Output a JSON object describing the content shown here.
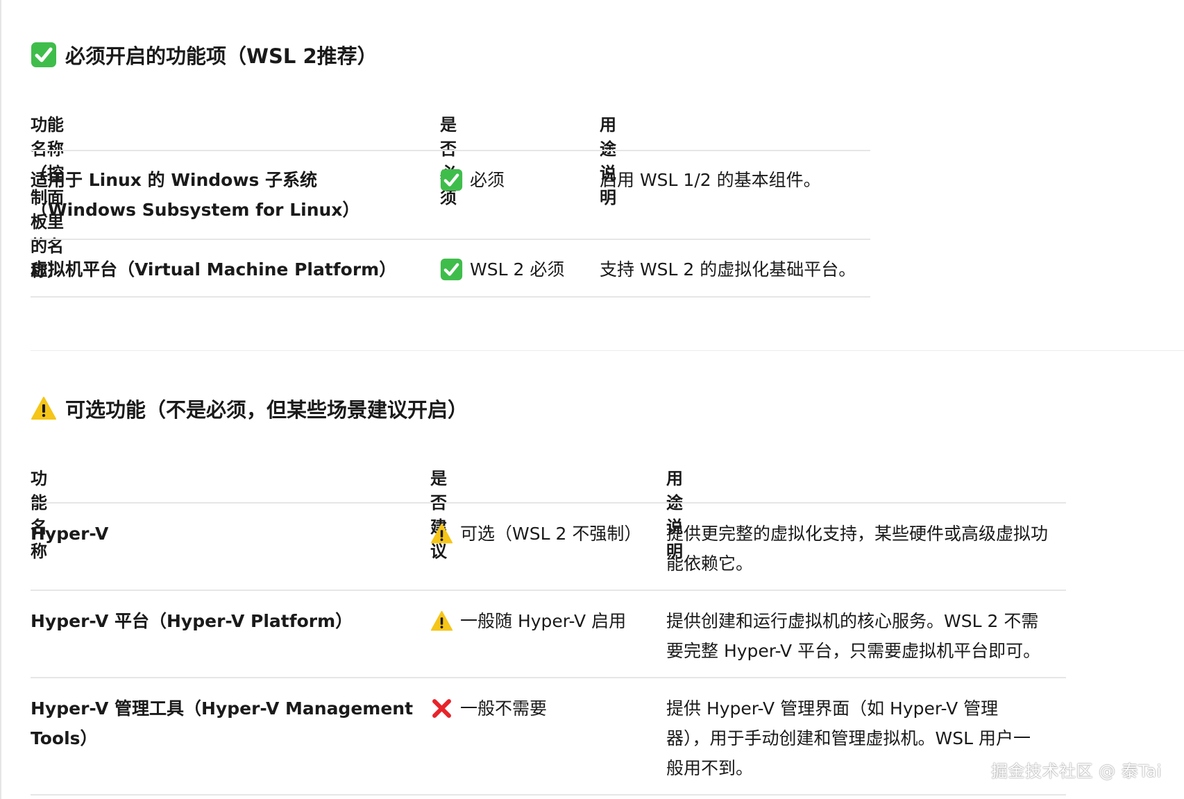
{
  "section1": {
    "title": "必须开启的功能项（WSL 2推荐）",
    "columns": [
      "功能名称（控制面板里的名称）",
      "是否必须",
      "用途说明"
    ],
    "rows": [
      {
        "name": "适用于 Linux 的 Windows 子系统（Windows Subsystem for Linux）",
        "status_icon": "check-icon",
        "status": "必须",
        "desc": "启用 WSL 1/2 的基本组件。"
      },
      {
        "name": "虚拟机平台（Virtual Machine Platform）",
        "status_icon": "check-icon",
        "status": "WSL 2 必须",
        "desc": "支持 WSL 2 的虚拟化基础平台。"
      }
    ]
  },
  "section2": {
    "title": "可选功能（不是必须，但某些场景建议开启）",
    "columns": [
      "功能名称",
      "是否建议",
      "用途说明"
    ],
    "rows": [
      {
        "name": "Hyper-V",
        "status_icon": "warning-icon",
        "status": "可选（WSL 2 不强制）",
        "desc": "提供更完整的虚拟化支持，某些硬件或高级虚拟功能依赖它。"
      },
      {
        "name": "Hyper-V 平台（Hyper-V Platform）",
        "status_icon": "warning-icon",
        "status": "一般随 Hyper-V 启用",
        "desc": "提供创建和运行虚拟机的核心服务。WSL 2 不需要完整 Hyper-V 平台，只需要虚拟机平台即可。"
      },
      {
        "name": "Hyper-V 管理工具（Hyper-V Management Tools）",
        "status_icon": "cross-icon",
        "status": "一般不需要",
        "desc": "提供 Hyper-V 管理界面（如 Hyper-V 管理器），用于手动创建和管理虚拟机。WSL 用户一般用不到。"
      }
    ]
  },
  "colors": {
    "check_green": "#3fbd4b",
    "warning_yellow": "#f5c518",
    "cross_red": "#e8232a",
    "rule": "#e6e6e6"
  },
  "watermark": "掘金技术社区 @ 泰Tai"
}
